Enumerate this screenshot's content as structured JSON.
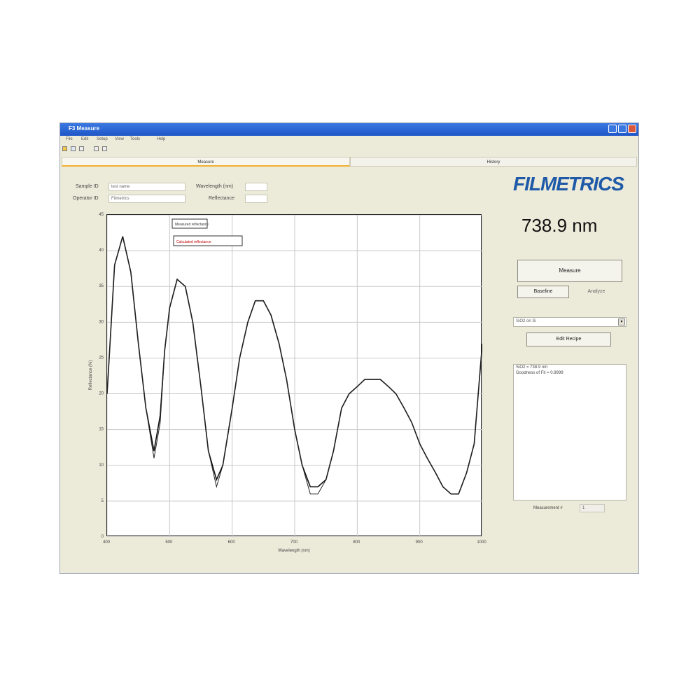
{
  "window": {
    "title": "F3 Measure"
  },
  "menu": [
    "File",
    "Edit",
    "Setup",
    "View",
    "Tools",
    "Help"
  ],
  "tabs": [
    {
      "label": "Measure",
      "active": true
    },
    {
      "label": "History",
      "active": false
    }
  ],
  "form": {
    "sample_id_label": "Sample ID",
    "sample_id_value": "test name",
    "operator_id_label": "Operator ID",
    "operator_id_value": "Filmetrics",
    "wavelength_label": "Wavelength (nm)",
    "wavelength_value": "",
    "reflectance_label": "Reflectance",
    "reflectance_value": ""
  },
  "logo": "FILMETRICS",
  "thickness": "738.9 nm",
  "buttons": {
    "measure": "Measure",
    "baseline": "Baseline",
    "analyze": "Analyze",
    "edit_recipe": "Edit Recipe"
  },
  "recipe_select": {
    "value": "SiO2 on Si"
  },
  "results_lines": [
    "SiO2 = 738.9 nm",
    "Goodness of Fit = 0.9999"
  ],
  "measurement_label": "Measurement #",
  "measurement_value": "1",
  "colors": {
    "measured": "#111111",
    "calculated": "#222222",
    "legend_calc": "#c00000",
    "logo": "#1e5aa8",
    "titlebar": "#2a63d4"
  },
  "chart_data": {
    "type": "line",
    "xlabel": "Wavelength (nm)",
    "ylabel": "Reflectance (%)",
    "xlim": [
      400,
      1000
    ],
    "ylim": [
      0,
      45
    ],
    "x_ticks": [
      "400",
      "500",
      "600",
      "700",
      "800",
      "900",
      "1000"
    ],
    "y_ticks": [
      "0",
      "5",
      "10",
      "15",
      "20",
      "25",
      "30",
      "35",
      "40",
      "45"
    ],
    "grid": true,
    "legend": [
      "Measured reflectance",
      "Calculated reflectance"
    ],
    "series": [
      {
        "name": "Measured reflectance",
        "x": [
          400,
          412,
          425,
          438,
          450,
          462,
          475,
          485,
          492,
          500,
          512,
          525,
          537,
          550,
          562,
          575,
          585,
          600,
          612,
          625,
          637,
          650,
          662,
          675,
          687,
          700,
          712,
          725,
          737,
          750,
          762,
          775,
          787,
          800,
          812,
          825,
          837,
          850,
          862,
          875,
          887,
          900,
          912,
          925,
          937,
          950,
          962,
          975,
          987,
          1000
        ],
        "y": [
          20,
          38,
          42,
          37,
          27,
          18,
          12,
          17,
          26,
          32,
          36,
          35,
          30,
          21,
          12,
          8,
          10,
          18,
          25,
          30,
          33,
          33,
          31,
          27,
          22,
          15,
          10,
          7,
          7,
          8,
          12,
          18,
          20,
          21,
          22,
          22,
          22,
          21,
          20,
          18,
          16,
          13,
          11,
          9,
          7,
          6,
          6,
          9,
          13,
          27
        ],
        "color": "#111111"
      },
      {
        "name": "Calculated reflectance",
        "x": [
          400,
          412,
          425,
          438,
          450,
          462,
          475,
          485,
          492,
          500,
          512,
          525,
          537,
          550,
          562,
          575,
          585,
          600,
          612,
          625,
          637,
          650,
          662,
          675,
          687,
          700,
          712,
          725,
          737,
          750,
          762,
          775,
          787,
          800,
          812,
          825,
          837,
          850,
          862,
          875,
          887,
          900,
          912,
          925,
          937,
          950,
          962,
          975,
          987,
          1000
        ],
        "y": [
          20,
          38,
          42,
          37,
          27,
          18,
          11,
          16,
          26,
          32,
          36,
          35,
          30,
          21,
          12,
          7,
          10,
          18,
          25,
          30,
          33,
          33,
          31,
          27,
          22,
          15,
          10,
          6,
          6,
          8,
          12,
          18,
          20,
          21,
          22,
          22,
          22,
          21,
          20,
          18,
          16,
          13,
          11,
          9,
          7,
          6,
          6,
          9,
          13,
          27
        ],
        "color": "#222222"
      }
    ]
  }
}
